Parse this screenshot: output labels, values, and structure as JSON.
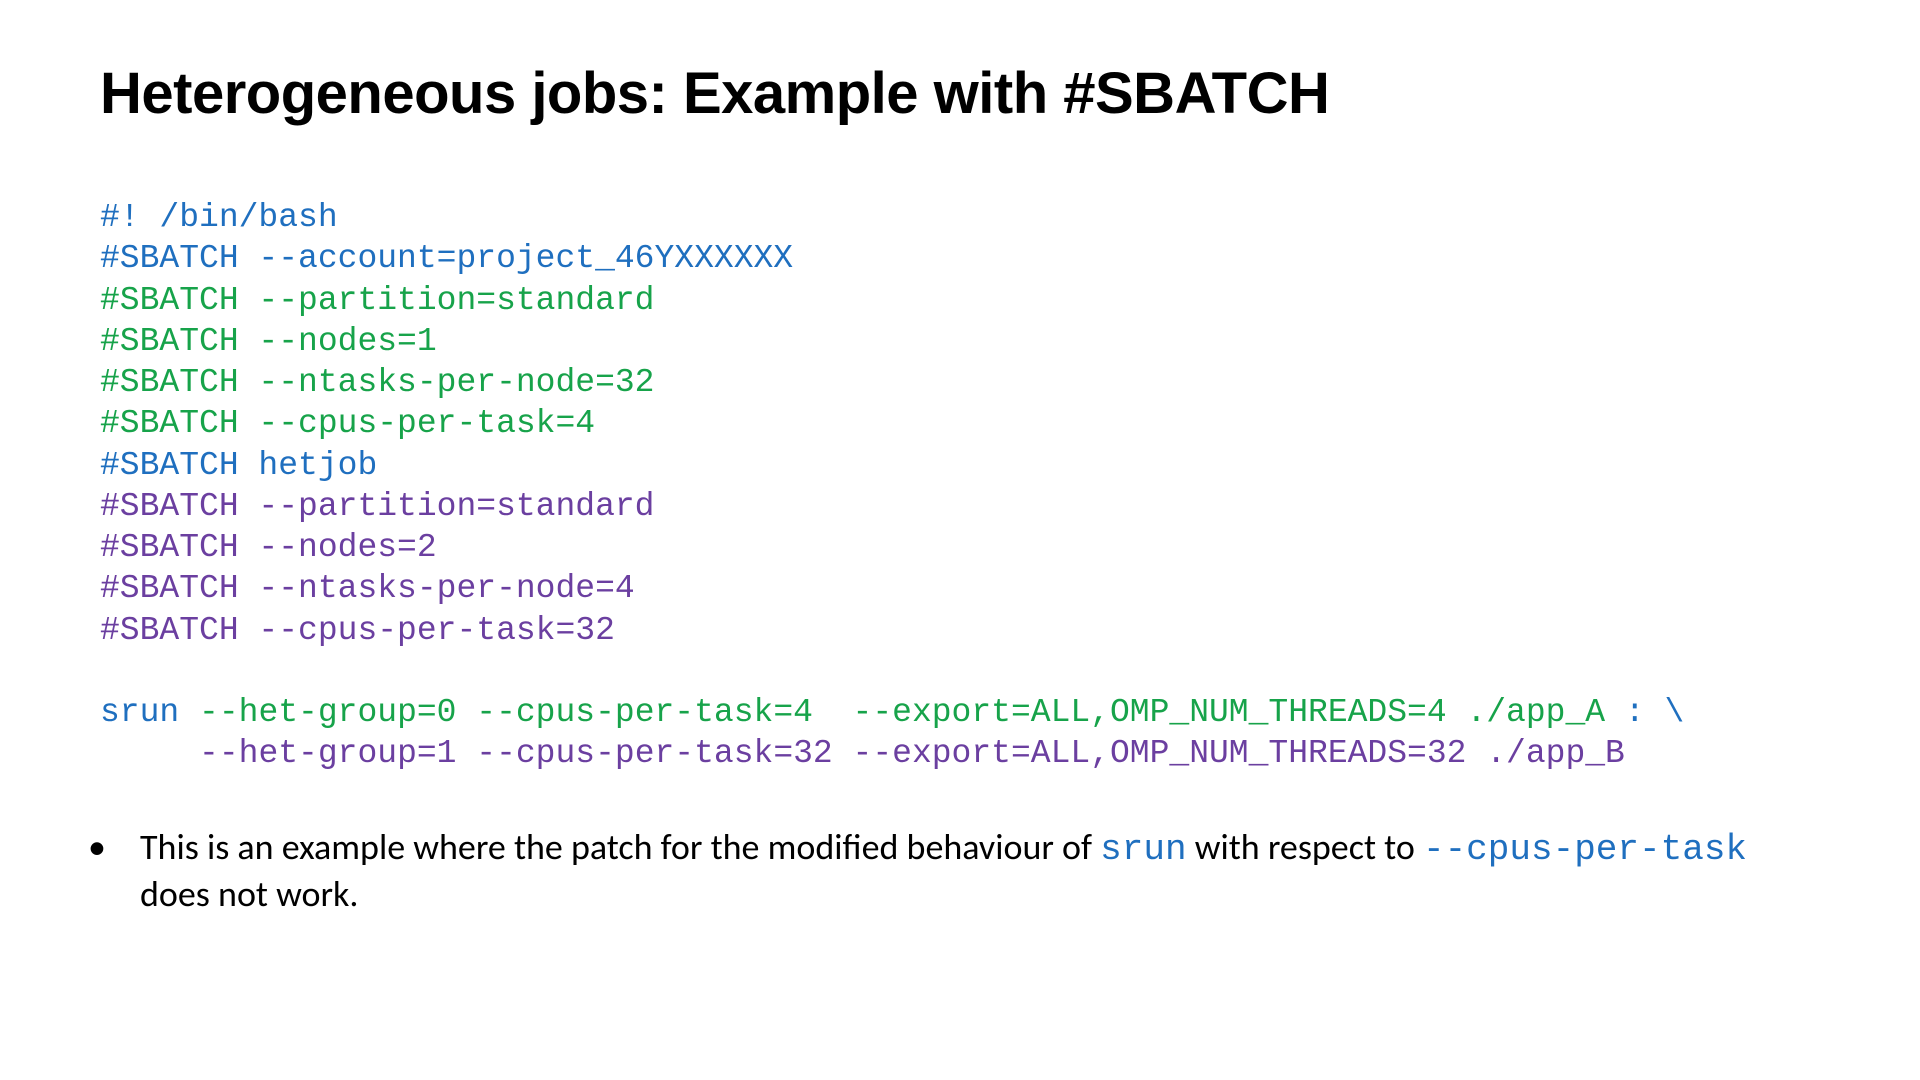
{
  "title": "Heterogeneous jobs: Example with #SBATCH",
  "code": {
    "l1": "#! /bin/bash",
    "l2": "#SBATCH --account=project_46YXXXXXX",
    "l3": "#SBATCH --partition=standard",
    "l4": "#SBATCH --nodes=1",
    "l5": "#SBATCH --ntasks-per-node=32",
    "l6": "#SBATCH --cpus-per-task=4",
    "l7": "#SBATCH hetjob",
    "l8": "#SBATCH --partition=standard",
    "l9": "#SBATCH --nodes=2",
    "l10": "#SBATCH --ntasks-per-node=4",
    "l11": "#SBATCH --cpus-per-task=32",
    "srun_lead": "srun ",
    "srun_g0": "--het-group=0 --cpus-per-task=4  --export=ALL,OMP_NUM_THREADS=4 ./app_A",
    "srun_colon": " : ",
    "srun_back": "\\",
    "srun_g1_pad": "     ",
    "srun_g1": "--het-group=1 --cpus-per-task=32 --export=ALL,OMP_NUM_THREADS=32 ./app_B"
  },
  "bullet": {
    "t1": "This is an example where the patch for the modified behaviour of ",
    "c1": "srun",
    "t2": " with respect to  ",
    "c2": "--cpus-per-task",
    "t3": " does not work."
  }
}
